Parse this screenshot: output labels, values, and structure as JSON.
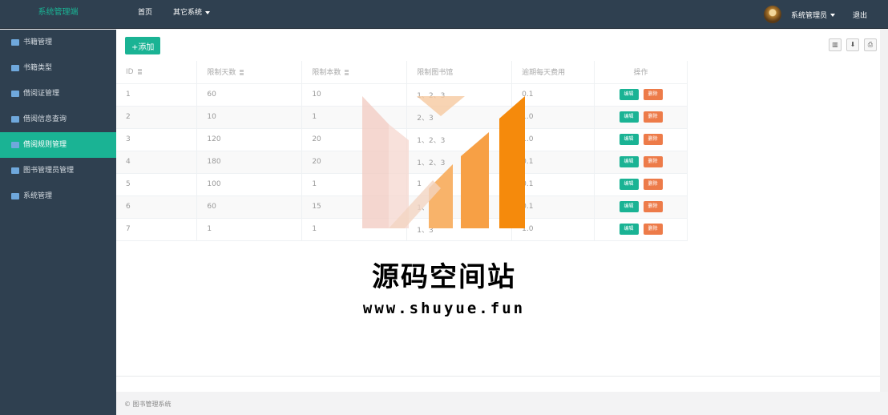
{
  "app": {
    "brand": "系统管理端"
  },
  "topnav": {
    "home": "首页",
    "system": "其它系统"
  },
  "user": {
    "name": "系统管理员",
    "logout": "退出"
  },
  "sidebar": {
    "items": [
      {
        "label": "书籍管理",
        "active": false
      },
      {
        "label": "书籍类型",
        "active": false
      },
      {
        "label": "借阅证管理",
        "active": false
      },
      {
        "label": "借阅信息查询",
        "active": false
      },
      {
        "label": "借阅规则管理",
        "active": true
      },
      {
        "label": "图书管理员管理",
        "active": false
      },
      {
        "label": "系统管理",
        "active": false
      }
    ]
  },
  "toolbar": {
    "add_label": "+添加"
  },
  "table": {
    "headers": [
      "ID",
      "限制天数",
      "限制本数",
      "限制图书馆",
      "逾期每天费用",
      "操作"
    ],
    "rows": [
      [
        "1",
        "60",
        "10",
        "1、2、3",
        "0.1"
      ],
      [
        "2",
        "10",
        "1",
        "2、3",
        "1.0"
      ],
      [
        "3",
        "120",
        "20",
        "1、2、3",
        "1.0"
      ],
      [
        "4",
        "180",
        "20",
        "1、2、3",
        "0.1"
      ],
      [
        "5",
        "100",
        "1",
        "1",
        "0.1"
      ],
      [
        "6",
        "60",
        "15",
        "1、2",
        "0.1"
      ],
      [
        "7",
        "1",
        "1",
        "1、3",
        "1.0"
      ]
    ],
    "edit_label": "编辑",
    "delete_label": "删除"
  },
  "footer": {
    "text": "© 图书管理系统"
  },
  "watermark": {
    "title": "源码空间站",
    "url": "www.shuyue.fun"
  }
}
